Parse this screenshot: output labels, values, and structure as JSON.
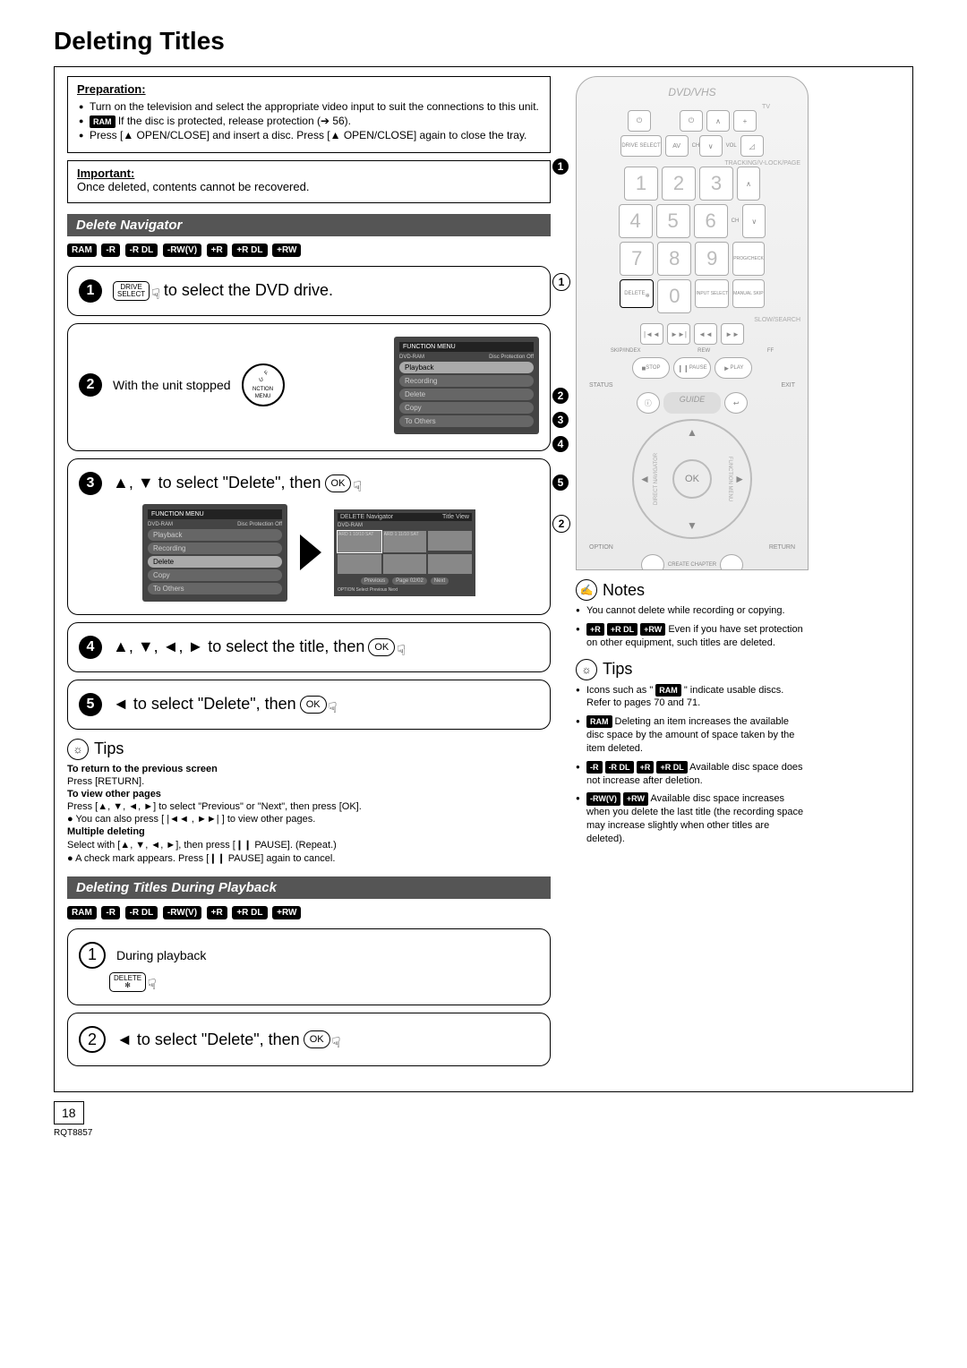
{
  "page_title": "Deleting Titles",
  "preparation": {
    "label": "Preparation:",
    "items": [
      "Turn on the television and select the appropriate video input to suit the connections to this unit.",
      " If the disc is protected, release protection (➔ 56).",
      "Press [▲ OPEN/CLOSE] and insert a disc. Press [▲ OPEN/CLOSE] again to close the tray."
    ],
    "ram_prefix": "RAM"
  },
  "important": {
    "label": "Important:",
    "text": "Once deleted, contents cannot be recovered."
  },
  "section1_title": "Delete Navigator",
  "disc_badges": [
    "RAM",
    "-R",
    "-R DL",
    "-RW(V)",
    "+R",
    "+R DL",
    "+RW"
  ],
  "step1": {
    "btn_line1": "DRIVE",
    "btn_line2": "SELECT",
    "text": "to select the DVD drive."
  },
  "step2_text": "With the unit stopped",
  "fn_menu_label": "FUNCTION MENU",
  "menu": {
    "header_left": "FUNCTION MENU",
    "dvd_ram": "DVD-RAM",
    "protection": "Disc Protection Off",
    "items": [
      "Playback",
      "Recording",
      "Delete",
      "Copy",
      "To Others"
    ]
  },
  "step3_text_a": "▲, ▼ to select \"Delete\", then",
  "nav": {
    "title": "DELETE Navigator",
    "title_view": "Title View",
    "dvd": "DVD-RAM",
    "cell1": "ARD 1 10/10 SAT",
    "cell2": "ARD 1 11/10 SAT",
    "prev": "Previous",
    "page": "Page 02/02",
    "next": "Next",
    "footer": "OPTION    Select    Previous   Next"
  },
  "step4_text": "▲, ▼, ◄, ► to select the title, then",
  "step5_text": "◄ to select \"Delete\", then",
  "ok_label": "OK",
  "tips": {
    "title": "Tips",
    "return_h": "To return to the previous screen",
    "return_t": "Press [RETURN].",
    "view_h": "To view other pages",
    "view_t1": "Press [▲, ▼, ◄, ►] to select \"Previous\" or \"Next\", then press [OK].",
    "view_t2": "You can also press [ |◄◄ , ►►| ] to view other pages.",
    "mult_h": "Multiple deleting",
    "mult_t1": "Select with [▲, ▼, ◄, ►], then press [❙❙ PAUSE]. (Repeat.)",
    "mult_t2": "A check mark appears. Press [❙❙ PAUSE] again to cancel."
  },
  "section2_title": "Deleting Titles During Playback",
  "pb_step1_text": "During playback",
  "pb_step1_btn": "DELETE",
  "pb_step2_text": "◄ to select \"Delete\", then",
  "remote": {
    "title": "DVD/VHS",
    "tv": "TV",
    "drive_select": "DRIVE SELECT",
    "ch": "CH",
    "vol": "VOL",
    "av": "AV",
    "tracking": "TRACKING/V-LOCK/PAGE",
    "nums": [
      "1",
      "2",
      "3",
      "4",
      "5",
      "6",
      "7",
      "8",
      "9",
      "0"
    ],
    "prog": "PROG/CHECK",
    "delete": "DELETE",
    "input": "INPUT SELECT",
    "manual": "MANUAL SKIP",
    "slow": "SLOW/SEARCH",
    "skip": "SKIP/INDEX",
    "rew": "REW",
    "ff": "FF",
    "stop": "STOP",
    "pause": "PAUSE",
    "play": "PLAY",
    "status": "STATUS",
    "exit": "EXIT",
    "guide": "GUIDE",
    "direct_nav": "DIRECT NAVIGATOR",
    "fn_menu": "FUNCTION MENU",
    "ok": "OK",
    "option": "OPTION",
    "return": "RETURN",
    "create": "CREATE CHAPTER"
  },
  "notes": {
    "title": "Notes",
    "items": [
      "You cannot delete while recording or copying.",
      " Even if you have set protection on other equipment, such titles are deleted."
    ],
    "n2_badges": [
      "+R",
      "+R DL",
      "+RW"
    ]
  },
  "right_tips": {
    "title": "Tips",
    "l1a": "Icons such as \" ",
    "l1b": " \" indicate usable discs. Refer to pages 70 and 71.",
    "l1_badge": "RAM",
    "l2_badge": "RAM",
    "l2": " Deleting an item increases the available disc space by the amount of space taken by the item deleted.",
    "l3_badges": [
      "-R",
      "-R DL",
      "+R",
      "+R DL"
    ],
    "l3": " Available disc space does not increase after deletion.",
    "l4_badges": [
      "-RW(V)",
      "+RW"
    ],
    "l4": " Available disc space increases when you delete the last title (the recording space may increase slightly when other titles are deleted)."
  },
  "page_number": "18",
  "model": "RQT8857"
}
